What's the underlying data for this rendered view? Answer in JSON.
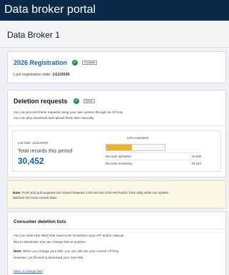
{
  "header": {
    "title": "Data broker portal"
  },
  "broker": {
    "name": "Data Broker 1"
  },
  "registration": {
    "title": "2026 Registration",
    "status_badge": "Complete",
    "last_label": "Last registration date:",
    "last_value": "1/11/2026"
  },
  "deletion": {
    "title": "Deletion requests",
    "status_badge": "Active",
    "desc_line1": "You can process these requests using your own system through an API key.",
    "desc_line2": "You can also download and upload these lists manually.",
    "list_date": "List date: 11/11/2026",
    "total_label": "Total records this period",
    "total_value": "30,452",
    "percent_label": "44% completed",
    "percent_value": 0.44,
    "uploaded_label": "Records uploaded",
    "uploaded_value": "10,308",
    "remaining_label": "Records remaining",
    "remaining_value": "20,144"
  },
  "note": {
    "label": "Note:",
    "line1": "Push and pull requests are closed between 1:00 AM and 3:00 AM Pacific Time daily while our system",
    "line2": "batches the most current data."
  },
  "lists": {
    "title": "Consumer deletion lists",
    "p1_line1": "You can select the list(s) that need to be included in your API and/or manual",
    "p1_line2": "lists to download. You can change lists at anytime.",
    "note_label": "Note:",
    "p2_line1": "When you change your lists, you can still use your current API key.",
    "p2_line2": "However, you'll need to download your new lists.",
    "link": "View or change lists"
  },
  "colors": {
    "brand": "#0b2a4a",
    "accent": "#1d5fa8",
    "progress": "#f0b323",
    "success": "#2e8b47"
  },
  "icons": {
    "status": "check-circle-icon"
  }
}
